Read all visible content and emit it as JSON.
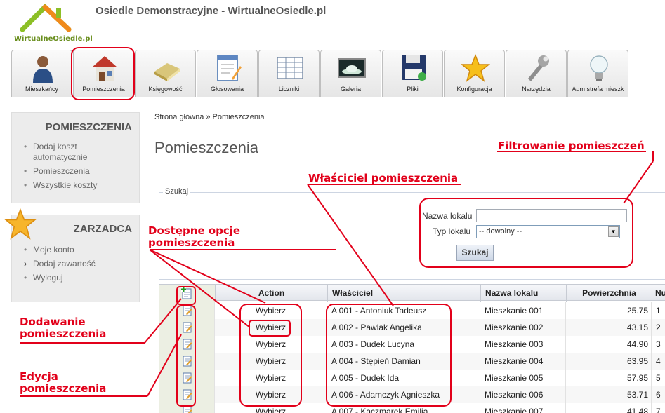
{
  "header": {
    "logo_text": "WirtualneOsiedle.pl",
    "site_title": "Osiedle Demonstracyjne - WirtualneOsiedle.pl"
  },
  "toolbar": [
    {
      "label": "Mieszkańcy",
      "icon": "person-icon"
    },
    {
      "label": "Pomieszczenia",
      "icon": "house-icon"
    },
    {
      "label": "Księgowość",
      "icon": "books-icon"
    },
    {
      "label": "Głosowania",
      "icon": "voting-form-icon"
    },
    {
      "label": "Liczniki",
      "icon": "spreadsheet-icon"
    },
    {
      "label": "Galeria",
      "icon": "gallery-icon"
    },
    {
      "label": "Pliki",
      "icon": "floppy-disk-icon"
    },
    {
      "label": "Konfiguracja",
      "icon": "star-icon"
    },
    {
      "label": "Narzędzia",
      "icon": "wrench-icon"
    },
    {
      "label": "Adm strefa mieszk",
      "icon": "lightbulb-icon"
    }
  ],
  "sidebar": {
    "section1": {
      "title": "POMIESZCZENIA",
      "items": [
        "Dodaj koszt automatycznie",
        "Pomieszczenia",
        "Wszystkie koszty"
      ]
    },
    "section2": {
      "title": "ZARZADCA",
      "items": [
        "Moje konto",
        "Dodaj zawartość",
        "Wyloguj"
      ]
    }
  },
  "main": {
    "breadcrumb": "Strona główna » Pomieszczenia",
    "title": "Pomieszczenia"
  },
  "search": {
    "legend": "Szukaj",
    "name_label": "Nazwa lokalu",
    "name_value": "",
    "type_label": "Typ lokalu",
    "type_value": "-- dowolny --",
    "button": "Szukaj"
  },
  "table": {
    "columns": [
      "Action",
      "Właściciel",
      "Nazwa lokalu",
      "Powierzchnia",
      "Nu"
    ],
    "rows": [
      {
        "action": "Wybierz",
        "owner": "A 001 - Antoniuk Tadeusz",
        "name": "Mieszkanie 001",
        "area": "25.75",
        "nr": "1"
      },
      {
        "action": "Wybierz",
        "owner": "A 002 - Pawlak Angelika",
        "name": "Mieszkanie 002",
        "area": "43.15",
        "nr": "2"
      },
      {
        "action": "Wybierz",
        "owner": "A 003 - Dudek Lucyna",
        "name": "Mieszkanie 003",
        "area": "44.90",
        "nr": "3"
      },
      {
        "action": "Wybierz",
        "owner": "A 004 - Stępień Damian",
        "name": "Mieszkanie 004",
        "area": "63.95",
        "nr": "4"
      },
      {
        "action": "Wybierz",
        "owner": "A 005 - Dudek Ida",
        "name": "Mieszkanie 005",
        "area": "57.95",
        "nr": "5"
      },
      {
        "action": "Wybierz",
        "owner": "A 006 - Adamczyk Agnieszka",
        "name": "Mieszkanie 006",
        "area": "53.71",
        "nr": "6"
      },
      {
        "action": "Wybierz",
        "owner": "A 007 - Kaczmarek Emilia",
        "name": "Mieszkanie 007",
        "area": "41.48",
        "nr": "7"
      }
    ]
  },
  "annotations": {
    "filter": "Filtrowanie pomieszczeń",
    "owner": "Właściciel pomieszczenia",
    "options_line1": "Dostępne opcje",
    "options_line2": "pomieszczenia",
    "add_line1": "Dodawanie",
    "add_line2": "pomieszczenia",
    "edit_line1": "Edycja",
    "edit_line2": "pomieszczenia",
    "color": "#e2001a"
  }
}
